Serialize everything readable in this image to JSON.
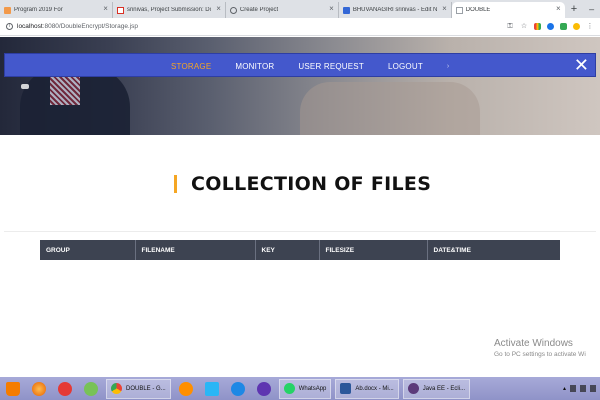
{
  "browser": {
    "tabs": [
      {
        "title": "Program 2019 For",
        "favicon_color": "#f2994a",
        "active": false
      },
      {
        "title": "srinivas, Project Submission: Do",
        "favicon_color": "#d93025",
        "active": false
      },
      {
        "title": "Create Project",
        "favicon_color": "#5f6368",
        "active": false
      },
      {
        "title": "BHUVANAGIRI srinivas - Edit N",
        "favicon_color": "#3367d6",
        "active": false
      },
      {
        "title": "DOUBLE",
        "favicon_color": "#9aa0a6",
        "active": true
      }
    ],
    "new_tab_label": "+",
    "close_glyph": "×",
    "address": {
      "host": "localhost",
      "port_path": ":8080/DoubleEncrypt/Storage.jsp"
    }
  },
  "nav": {
    "items": [
      {
        "label": "STORAGE",
        "active": true
      },
      {
        "label": "MONITOR",
        "active": false
      },
      {
        "label": "USER REQUEST",
        "active": false
      },
      {
        "label": "LOGOUT",
        "active": false
      }
    ],
    "more_glyph": "›",
    "close_glyph": "✕"
  },
  "page": {
    "title": "COLLECTION OF FILES",
    "table": {
      "columns": [
        "GROUP",
        "FILENAME",
        "KEY",
        "FILESIZE",
        "DATE&TIME"
      ],
      "rows": []
    },
    "accent_color": "#f5a623",
    "nav_color": "#4458cc",
    "table_header_color": "#3d4351"
  },
  "watermark": {
    "line1": "Activate Windows",
    "line2": "Go to PC settings to activate Wi"
  },
  "taskbar": {
    "buttons": [
      {
        "label": "DOUBLE - G...",
        "icon_color": "#4285f4"
      },
      {
        "label": "WhatsApp",
        "icon_color": "#25d366"
      },
      {
        "label": "Ab.docx - Mi...",
        "icon_color": "#2b579a"
      },
      {
        "label": "Java EE - Ecli...",
        "icon_color": "#5c3a7a"
      }
    ]
  }
}
